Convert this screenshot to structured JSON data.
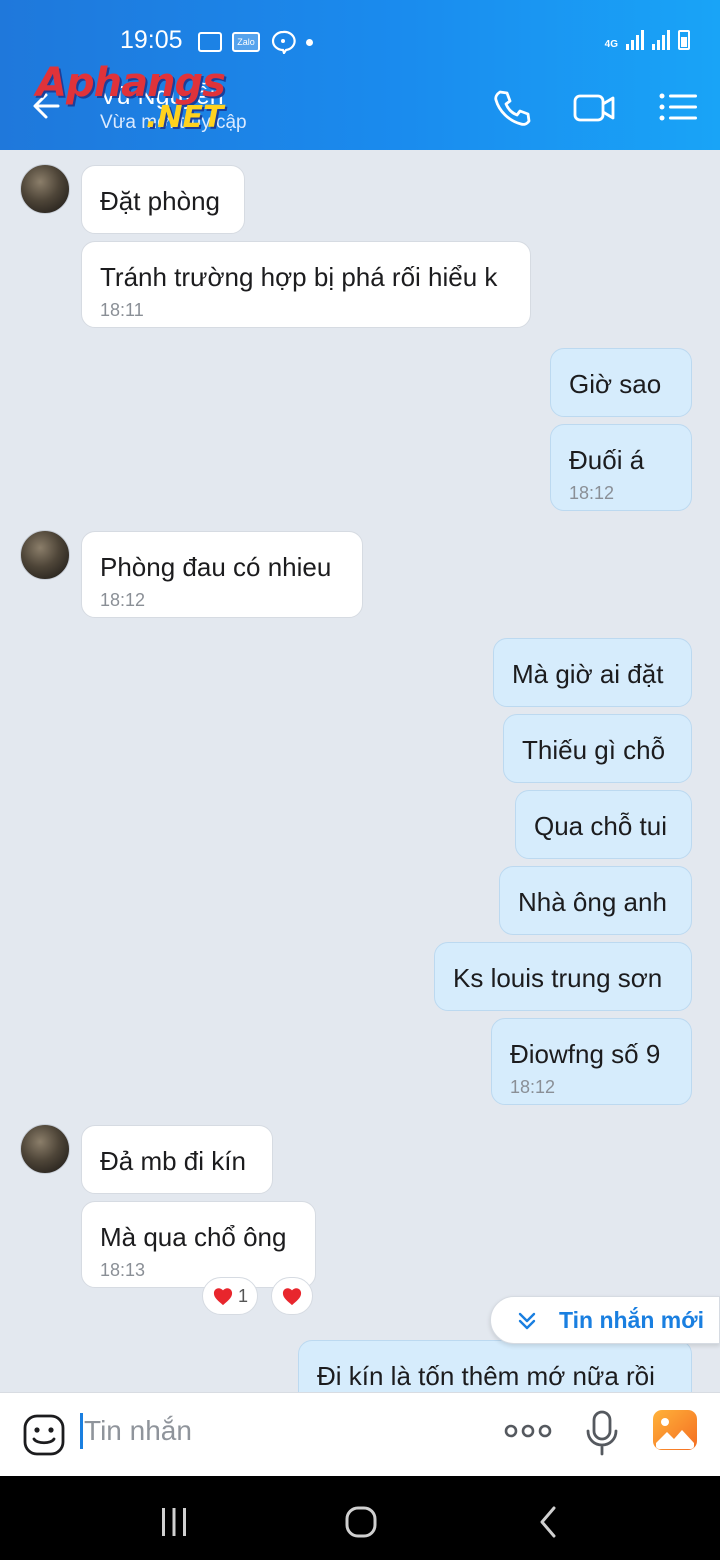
{
  "status_bar": {
    "time": "19:05",
    "zalo_label": "Zalo",
    "network": "4G"
  },
  "header": {
    "contact_name": "Vũ Nguyễn",
    "contact_status": "Vừa mới truy cập",
    "watermark_main": "Aphangs",
    "watermark_sub": ".NET"
  },
  "messages": [
    {
      "dir": "in",
      "text": "Đặt phòng",
      "time": ""
    },
    {
      "dir": "in",
      "text": "Tránh trường hợp bị phá rối hiểu k",
      "time": "18:11"
    },
    {
      "dir": "out",
      "text": "Giờ sao",
      "time": ""
    },
    {
      "dir": "out",
      "text": "Đuối á",
      "time": "18:12"
    },
    {
      "dir": "in",
      "text": "Phòng đau có nhieu",
      "time": "18:12"
    },
    {
      "dir": "out",
      "text": "Mà giờ ai đặt",
      "time": ""
    },
    {
      "dir": "out",
      "text": "Thiếu gì chỗ",
      "time": ""
    },
    {
      "dir": "out",
      "text": "Qua chỗ tui",
      "time": ""
    },
    {
      "dir": "out",
      "text": "Nhà ông anh",
      "time": ""
    },
    {
      "dir": "out",
      "text": "Ks louis trung sơn",
      "time": ""
    },
    {
      "dir": "out",
      "text": "Điowfng số 9",
      "time": "18:12"
    },
    {
      "dir": "in",
      "text": "Đả mb đi kín",
      "time": ""
    },
    {
      "dir": "in",
      "text": "Mà qua chổ ông",
      "time": "18:13"
    },
    {
      "dir": "out",
      "text": "Đi kín là tốn thêm mớ nữa rồi",
      "time": ""
    }
  ],
  "reactions": {
    "heart_count": "1"
  },
  "new_messages_label": "Tin nhắn mới",
  "composer": {
    "placeholder": "Tin nhắn"
  },
  "colors": {
    "header_start": "#1f78db",
    "header_end": "#19a4f7",
    "outgoing_bubble": "#d6ecfc",
    "accent": "#1a7fe0",
    "heart": "#e8262d"
  }
}
